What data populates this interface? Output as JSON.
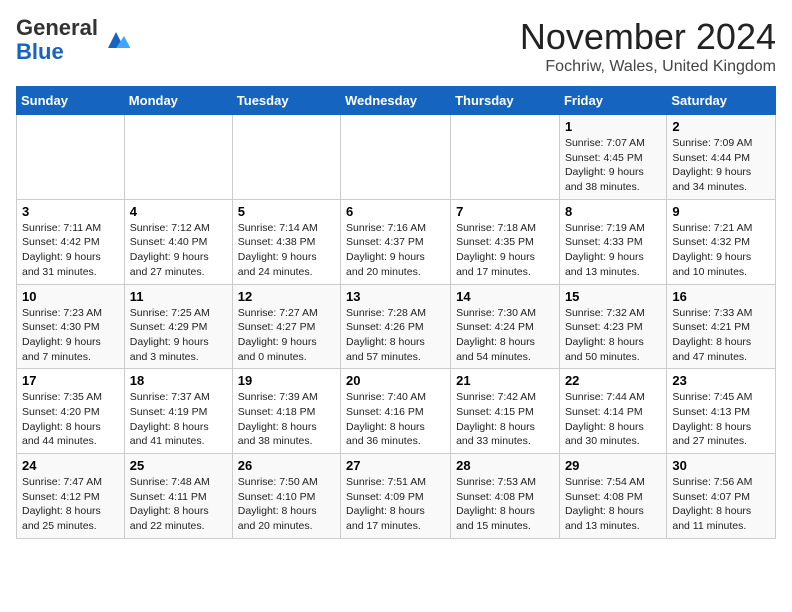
{
  "header": {
    "logo_general": "General",
    "logo_blue": "Blue",
    "month_title": "November 2024",
    "location": "Fochriw, Wales, United Kingdom"
  },
  "days_of_week": [
    "Sunday",
    "Monday",
    "Tuesday",
    "Wednesday",
    "Thursday",
    "Friday",
    "Saturday"
  ],
  "weeks": [
    [
      {
        "day": "",
        "info": ""
      },
      {
        "day": "",
        "info": ""
      },
      {
        "day": "",
        "info": ""
      },
      {
        "day": "",
        "info": ""
      },
      {
        "day": "",
        "info": ""
      },
      {
        "day": "1",
        "info": "Sunrise: 7:07 AM\nSunset: 4:45 PM\nDaylight: 9 hours and 38 minutes."
      },
      {
        "day": "2",
        "info": "Sunrise: 7:09 AM\nSunset: 4:44 PM\nDaylight: 9 hours and 34 minutes."
      }
    ],
    [
      {
        "day": "3",
        "info": "Sunrise: 7:11 AM\nSunset: 4:42 PM\nDaylight: 9 hours and 31 minutes."
      },
      {
        "day": "4",
        "info": "Sunrise: 7:12 AM\nSunset: 4:40 PM\nDaylight: 9 hours and 27 minutes."
      },
      {
        "day": "5",
        "info": "Sunrise: 7:14 AM\nSunset: 4:38 PM\nDaylight: 9 hours and 24 minutes."
      },
      {
        "day": "6",
        "info": "Sunrise: 7:16 AM\nSunset: 4:37 PM\nDaylight: 9 hours and 20 minutes."
      },
      {
        "day": "7",
        "info": "Sunrise: 7:18 AM\nSunset: 4:35 PM\nDaylight: 9 hours and 17 minutes."
      },
      {
        "day": "8",
        "info": "Sunrise: 7:19 AM\nSunset: 4:33 PM\nDaylight: 9 hours and 13 minutes."
      },
      {
        "day": "9",
        "info": "Sunrise: 7:21 AM\nSunset: 4:32 PM\nDaylight: 9 hours and 10 minutes."
      }
    ],
    [
      {
        "day": "10",
        "info": "Sunrise: 7:23 AM\nSunset: 4:30 PM\nDaylight: 9 hours and 7 minutes."
      },
      {
        "day": "11",
        "info": "Sunrise: 7:25 AM\nSunset: 4:29 PM\nDaylight: 9 hours and 3 minutes."
      },
      {
        "day": "12",
        "info": "Sunrise: 7:27 AM\nSunset: 4:27 PM\nDaylight: 9 hours and 0 minutes."
      },
      {
        "day": "13",
        "info": "Sunrise: 7:28 AM\nSunset: 4:26 PM\nDaylight: 8 hours and 57 minutes."
      },
      {
        "day": "14",
        "info": "Sunrise: 7:30 AM\nSunset: 4:24 PM\nDaylight: 8 hours and 54 minutes."
      },
      {
        "day": "15",
        "info": "Sunrise: 7:32 AM\nSunset: 4:23 PM\nDaylight: 8 hours and 50 minutes."
      },
      {
        "day": "16",
        "info": "Sunrise: 7:33 AM\nSunset: 4:21 PM\nDaylight: 8 hours and 47 minutes."
      }
    ],
    [
      {
        "day": "17",
        "info": "Sunrise: 7:35 AM\nSunset: 4:20 PM\nDaylight: 8 hours and 44 minutes."
      },
      {
        "day": "18",
        "info": "Sunrise: 7:37 AM\nSunset: 4:19 PM\nDaylight: 8 hours and 41 minutes."
      },
      {
        "day": "19",
        "info": "Sunrise: 7:39 AM\nSunset: 4:18 PM\nDaylight: 8 hours and 38 minutes."
      },
      {
        "day": "20",
        "info": "Sunrise: 7:40 AM\nSunset: 4:16 PM\nDaylight: 8 hours and 36 minutes."
      },
      {
        "day": "21",
        "info": "Sunrise: 7:42 AM\nSunset: 4:15 PM\nDaylight: 8 hours and 33 minutes."
      },
      {
        "day": "22",
        "info": "Sunrise: 7:44 AM\nSunset: 4:14 PM\nDaylight: 8 hours and 30 minutes."
      },
      {
        "day": "23",
        "info": "Sunrise: 7:45 AM\nSunset: 4:13 PM\nDaylight: 8 hours and 27 minutes."
      }
    ],
    [
      {
        "day": "24",
        "info": "Sunrise: 7:47 AM\nSunset: 4:12 PM\nDaylight: 8 hours and 25 minutes."
      },
      {
        "day": "25",
        "info": "Sunrise: 7:48 AM\nSunset: 4:11 PM\nDaylight: 8 hours and 22 minutes."
      },
      {
        "day": "26",
        "info": "Sunrise: 7:50 AM\nSunset: 4:10 PM\nDaylight: 8 hours and 20 minutes."
      },
      {
        "day": "27",
        "info": "Sunrise: 7:51 AM\nSunset: 4:09 PM\nDaylight: 8 hours and 17 minutes."
      },
      {
        "day": "28",
        "info": "Sunrise: 7:53 AM\nSunset: 4:08 PM\nDaylight: 8 hours and 15 minutes."
      },
      {
        "day": "29",
        "info": "Sunrise: 7:54 AM\nSunset: 4:08 PM\nDaylight: 8 hours and 13 minutes."
      },
      {
        "day": "30",
        "info": "Sunrise: 7:56 AM\nSunset: 4:07 PM\nDaylight: 8 hours and 11 minutes."
      }
    ]
  ]
}
